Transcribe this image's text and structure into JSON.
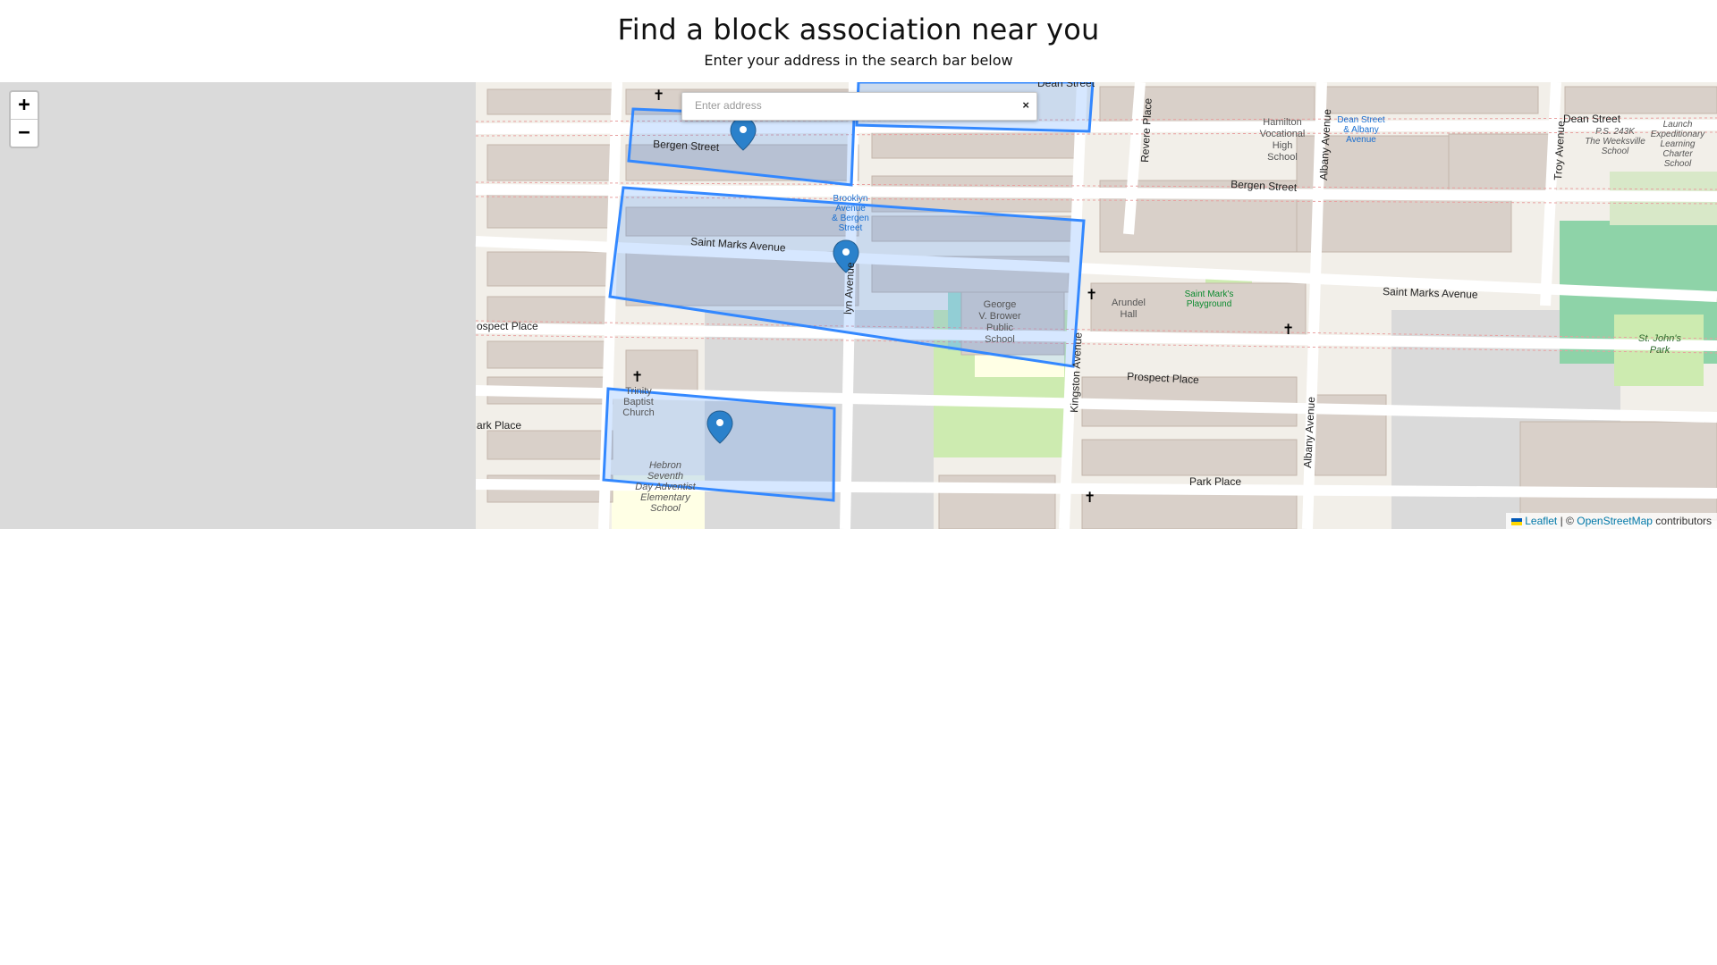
{
  "header": {
    "title": "Find a block association near you",
    "subtitle": "Enter your address in the search bar below"
  },
  "search": {
    "placeholder": "Enter address",
    "value": "",
    "clear_label": "×"
  },
  "zoom": {
    "in_label": "+",
    "out_label": "−"
  },
  "attribution": {
    "leaflet": "Leaflet",
    "separator": "| ©",
    "osm": "OpenStreetMap",
    "contributors": "contributors"
  },
  "map": {
    "streets": {
      "dean": "Dean Street",
      "bergen_w": "Bergen Street",
      "bergen_e": "Bergen Street",
      "saint_marks_w": "Saint Marks Avenue",
      "saint_marks_e": "Saint Marks Avenue",
      "prospect_w": "ospect Place",
      "prospect_e": "Prospect Place",
      "park_w": "ark Place",
      "park_e": "Park Place",
      "kingston": "Kingston Avenue",
      "albany_n": "Albany Avenue",
      "albany_s": "Albany Avenue",
      "revere": "Revere Place",
      "troy": "Troy Avenue",
      "brooklyn": "lyn Avenue",
      "dean_e": "Dean Street"
    },
    "places": {
      "hamilton": [
        "Hamilton",
        "Vocational",
        "High",
        "School"
      ],
      "brower": [
        "George",
        "V. Brower",
        "Public",
        "School"
      ],
      "trinity": [
        "Trinity",
        "Baptist",
        "Church"
      ],
      "hebron": [
        "Hebron",
        "Seventh",
        "Day Adventist",
        "Elementary",
        "School"
      ],
      "arundel": [
        "Arundel",
        "Hall"
      ],
      "playground": [
        "Saint Mark's",
        "Playground"
      ],
      "stjohns": [
        "St. John's",
        "Park"
      ],
      "launch": [
        "Launch",
        "Expeditionary",
        "Learning",
        "Charter",
        "School"
      ],
      "weeksville": [
        "P.S. 243K",
        "The Weeksville",
        "School"
      ],
      "stop_brooklyn": [
        "Brooklyn",
        "Avenue",
        "& Bergen",
        "Street"
      ],
      "stop_albany": [
        "Dean Street",
        "& Albany",
        "Avenue"
      ]
    },
    "colors": {
      "polygon_stroke": "#3388ff",
      "polygon_fill": "#3388ff",
      "marker": "#2a81cb",
      "park": "#cdebb0",
      "building": "#d9d0c9"
    }
  }
}
